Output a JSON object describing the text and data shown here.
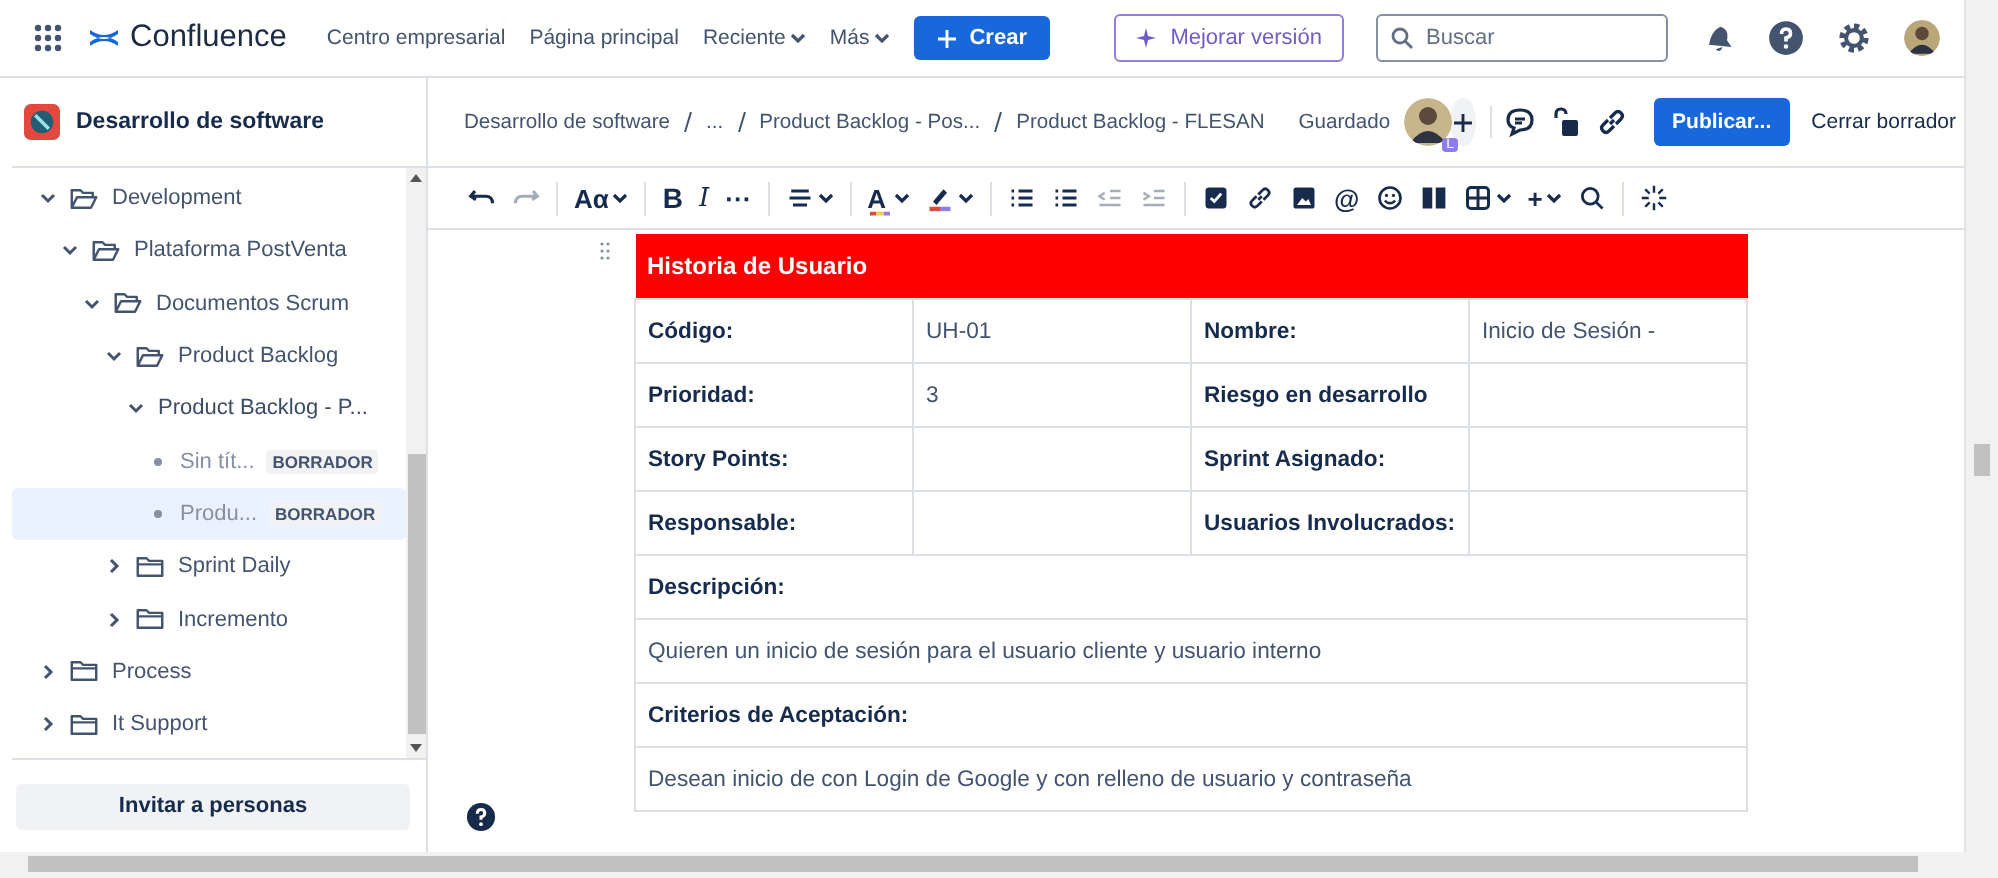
{
  "top_nav": {
    "product": "Confluence",
    "items": [
      {
        "label": "Centro empresarial",
        "kind": "link"
      },
      {
        "label": "Página principal",
        "kind": "link"
      },
      {
        "label": "Reciente",
        "kind": "dropdown"
      },
      {
        "label": "Más",
        "kind": "dropdown"
      }
    ],
    "create_button": "Crear",
    "upgrade_button": "Mejorar versión",
    "search": {
      "placeholder": "Buscar"
    }
  },
  "sidebar": {
    "space_title": "Desarrollo de software",
    "tree": [
      {
        "label": "Development",
        "kind": "folder",
        "expanded": true,
        "selected": false,
        "children": [
          {
            "label": "Plataforma PostVenta",
            "kind": "folder",
            "expanded": true,
            "selected": false,
            "children": [
              {
                "label": "Documentos Scrum",
                "kind": "folder",
                "expanded": true,
                "selected": false,
                "children": [
                  {
                    "label": "Product Backlog",
                    "kind": "folder",
                    "expanded": true,
                    "selected": false,
                    "children": [
                      {
                        "label": "Product Backlog - P...",
                        "kind": "page",
                        "expanded": true,
                        "selected": false,
                        "children": [
                          {
                            "label": "Sin tít...",
                            "kind": "draft",
                            "badge": "BORRADOR",
                            "selected": false
                          },
                          {
                            "label": "Produ...",
                            "kind": "draft",
                            "badge": "BORRADOR",
                            "selected": true
                          }
                        ]
                      }
                    ]
                  },
                  {
                    "label": "Sprint Daily",
                    "kind": "folder",
                    "expanded": false,
                    "selected": false
                  },
                  {
                    "label": "Incremento",
                    "kind": "folder",
                    "expanded": false,
                    "selected": false
                  }
                ]
              }
            ]
          }
        ]
      },
      {
        "label": "Process",
        "kind": "folder",
        "expanded": false,
        "selected": false
      },
      {
        "label": "It Support",
        "kind": "folder",
        "expanded": false,
        "selected": false
      }
    ],
    "invite_button": "Invitar a personas"
  },
  "page_header": {
    "breadcrumb": [
      "Desarrollo de software",
      "...",
      "Product Backlog - Pos...",
      "Product Backlog - FLESAN"
    ],
    "status": "Guardado",
    "collaborator_badge": "L",
    "publish_button": "Publicar...",
    "close_button": "Cerrar borrador"
  },
  "toolbar": [
    {
      "kind": "undo",
      "disabled": false
    },
    {
      "kind": "redo",
      "disabled": true
    },
    {
      "kind": "sep"
    },
    {
      "kind": "text",
      "label": "Aα",
      "caret": true
    },
    {
      "kind": "sep"
    },
    {
      "kind": "bold",
      "label": "B"
    },
    {
      "kind": "italic",
      "label": "I"
    },
    {
      "kind": "text",
      "label": "···"
    },
    {
      "kind": "sep"
    },
    {
      "kind": "align",
      "caret": true
    },
    {
      "kind": "sep"
    },
    {
      "kind": "color",
      "label": "A",
      "caret": true
    },
    {
      "kind": "highlight",
      "caret": true
    },
    {
      "kind": "sep"
    },
    {
      "kind": "bullets",
      "disabled": false
    },
    {
      "kind": "numbers",
      "disabled": false
    },
    {
      "kind": "outdent",
      "disabled": true
    },
    {
      "kind": "indent",
      "disabled": true
    },
    {
      "kind": "sep"
    },
    {
      "kind": "task"
    },
    {
      "kind": "link"
    },
    {
      "kind": "image"
    },
    {
      "kind": "text",
      "label": "@"
    },
    {
      "kind": "emoji"
    },
    {
      "kind": "layout"
    },
    {
      "kind": "table",
      "caret": true
    },
    {
      "kind": "text",
      "label": "+",
      "caret": true
    },
    {
      "kind": "search"
    },
    {
      "kind": "sep"
    },
    {
      "kind": "ai"
    }
  ],
  "table": {
    "title": "Historia de Usuario",
    "rows": [
      {
        "cells": [
          {
            "text": "Código:",
            "kind": "label"
          },
          {
            "text": "UH-01",
            "kind": "value"
          },
          {
            "text": "Nombre:",
            "kind": "label"
          },
          {
            "text": "Inicio de Sesión -",
            "kind": "value"
          }
        ]
      },
      {
        "cells": [
          {
            "text": "Prioridad:",
            "kind": "label"
          },
          {
            "text": "3",
            "kind": "value"
          },
          {
            "text": "Riesgo en desarrollo",
            "kind": "label"
          },
          {
            "text": "",
            "kind": "value"
          }
        ]
      },
      {
        "cells": [
          {
            "text": "Story Points:",
            "kind": "label"
          },
          {
            "text": "",
            "kind": "value"
          },
          {
            "text": "Sprint Asignado:",
            "kind": "label"
          },
          {
            "text": "",
            "kind": "value"
          }
        ]
      },
      {
        "cells": [
          {
            "text": "Responsable:",
            "kind": "label"
          },
          {
            "text": "",
            "kind": "value"
          },
          {
            "text": "Usuarios Involucrados:",
            "kind": "label"
          },
          {
            "text": "",
            "kind": "value"
          }
        ]
      },
      {
        "cells": [
          {
            "text": "Descripción:",
            "kind": "label",
            "colspan": 4
          }
        ]
      },
      {
        "cells": [
          {
            "text": "Quieren un inicio de sesión para el usuario cliente y usuario interno",
            "kind": "value",
            "colspan": 4
          }
        ]
      },
      {
        "cells": [
          {
            "text": "Criterios de Aceptación:",
            "kind": "label",
            "colspan": 4
          }
        ]
      },
      {
        "cells": [
          {
            "text": "Desean inicio de con Login de Google y con relleno de usuario y contraseña",
            "kind": "value",
            "colspan": 4
          }
        ]
      }
    ]
  }
}
